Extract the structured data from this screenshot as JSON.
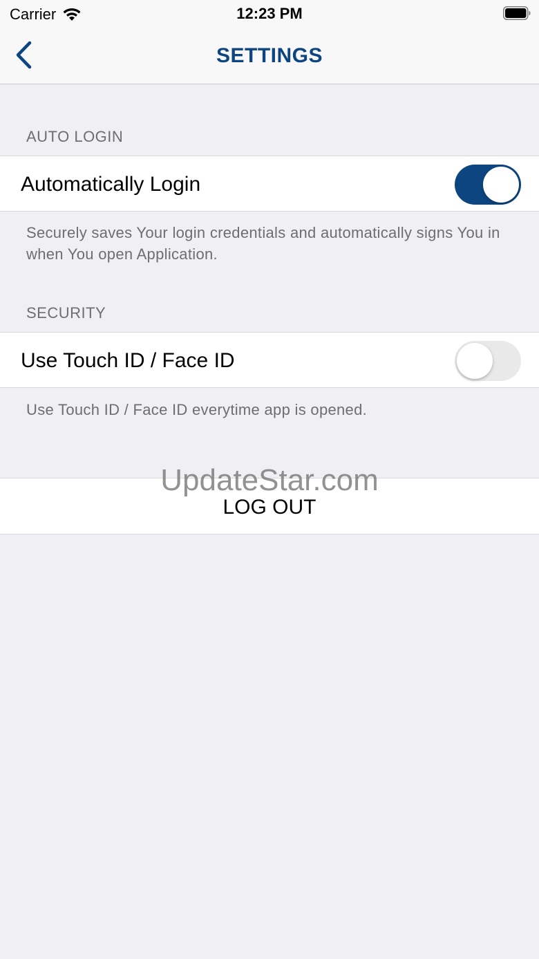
{
  "status_bar": {
    "carrier": "Carrier",
    "time": "12:23 PM"
  },
  "nav": {
    "title": "SETTINGS",
    "back_icon": "chevron-left-icon"
  },
  "colors": {
    "accent": "#0d4580",
    "background": "#efeff4",
    "secondary_text": "#6d6d72"
  },
  "sections": [
    {
      "header": "AUTO LOGIN",
      "cell_label": "Automatically Login",
      "toggle_on": true,
      "footer": "Securely saves Your login credentials and automatically signs You in when You open Application."
    },
    {
      "header": "SECURITY",
      "cell_label": "Use Touch ID / Face ID",
      "toggle_on": false,
      "footer": "Use Touch ID / Face ID everytime app is opened."
    }
  ],
  "logout_label": "LOG OUT",
  "watermark": "UpdateStar.com"
}
